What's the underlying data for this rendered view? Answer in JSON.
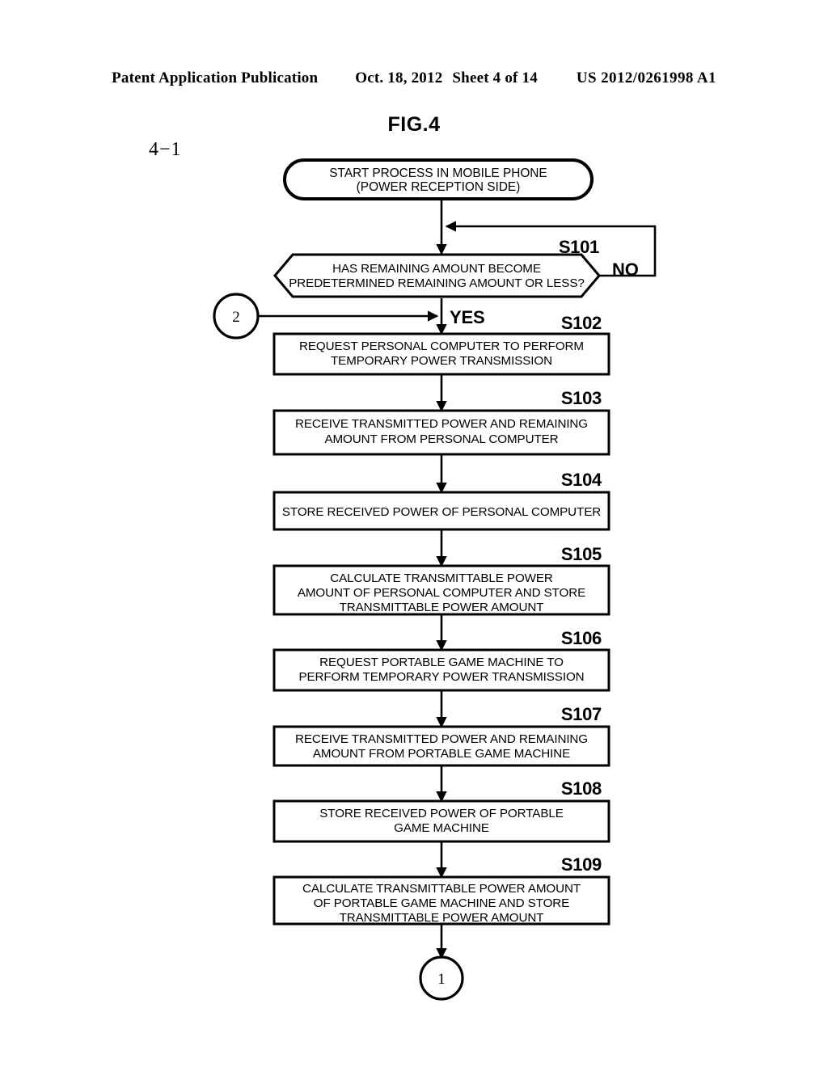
{
  "header": {
    "publication": "Patent Application Publication",
    "date": "Oct. 18, 2012",
    "sheet": "Sheet 4 of 14",
    "patent_number": "US 2012/0261998 A1"
  },
  "figure": {
    "title": "FIG.4",
    "sublabel": "4−1"
  },
  "flowchart": {
    "start": {
      "line1": "START PROCESS IN MOBILE PHONE",
      "line2": "(POWER RECEPTION SIDE)"
    },
    "decision": {
      "step": "S101",
      "line1": "HAS REMAINING AMOUNT BECOME",
      "line2": "PREDETERMINED REMAINING AMOUNT OR LESS?",
      "yes_label": "YES",
      "no_label": "NO"
    },
    "connector_in": "2",
    "connector_out": "1",
    "steps": [
      {
        "step": "S102",
        "lines": [
          "REQUEST PERSONAL COMPUTER TO PERFORM",
          "TEMPORARY POWER TRANSMISSION"
        ]
      },
      {
        "step": "S103",
        "lines": [
          "RECEIVE TRANSMITTED POWER AND REMAINING",
          "AMOUNT FROM PERSONAL COMPUTER"
        ]
      },
      {
        "step": "S104",
        "lines": [
          "STORE RECEIVED POWER OF PERSONAL COMPUTER"
        ]
      },
      {
        "step": "S105",
        "lines": [
          "CALCULATE TRANSMITTABLE POWER",
          "AMOUNT OF PERSONAL COMPUTER AND STORE",
          "TRANSMITTABLE POWER AMOUNT"
        ]
      },
      {
        "step": "S106",
        "lines": [
          "REQUEST PORTABLE GAME MACHINE TO",
          "PERFORM TEMPORARY POWER TRANSMISSION"
        ]
      },
      {
        "step": "S107",
        "lines": [
          "RECEIVE TRANSMITTED POWER AND REMAINING",
          "AMOUNT FROM PORTABLE GAME MACHINE"
        ]
      },
      {
        "step": "S108",
        "lines": [
          "STORE RECEIVED POWER OF PORTABLE",
          "GAME MACHINE"
        ]
      },
      {
        "step": "S109",
        "lines": [
          "CALCULATE TRANSMITTABLE POWER AMOUNT",
          "OF PORTABLE GAME MACHINE AND STORE",
          "TRANSMITTABLE POWER AMOUNT"
        ]
      }
    ]
  }
}
